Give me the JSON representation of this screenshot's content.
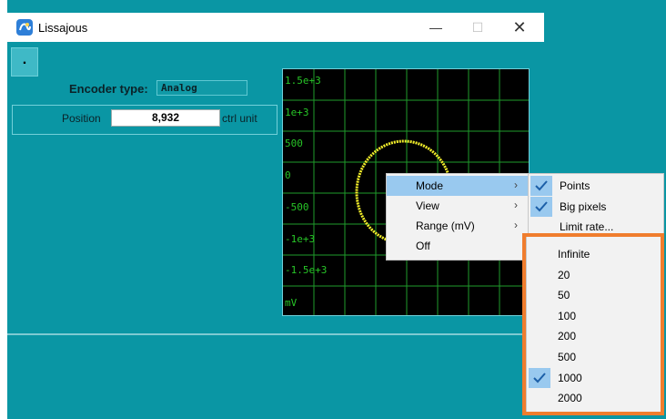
{
  "window": {
    "title": "Lissajous",
    "minimize_glyph": "—",
    "maximize_glyph": "☐",
    "close_glyph": "✕",
    "app_icon": "lissajous-app-icon"
  },
  "toolbar": {
    "dot_button_label": "."
  },
  "encoder": {
    "label": "Encoder type:",
    "value": "Analog"
  },
  "position": {
    "label": "Position",
    "value": "8,932",
    "unit": "ctrl unit"
  },
  "scope": {
    "y_labels": [
      "1.5e+3",
      "1e+3",
      "500",
      "0",
      "-500",
      "-1e+3",
      "-1.5e+3",
      "mV"
    ],
    "trace_color": "#f2ee2a",
    "grid_color": "#1f9b2b",
    "label_color": "#27c527"
  },
  "context_menu": {
    "items": [
      {
        "label": "Mode",
        "has_submenu": true,
        "highlighted": true
      },
      {
        "label": "View",
        "has_submenu": true,
        "highlighted": false
      },
      {
        "label": "Range (mV)",
        "has_submenu": true,
        "highlighted": false
      },
      {
        "label": "Off",
        "has_submenu": false,
        "highlighted": false
      }
    ],
    "arrow_glyph": "›"
  },
  "mode_submenu": {
    "items": [
      {
        "label": "Points",
        "checked": true
      },
      {
        "label": "Big pixels",
        "checked": true
      },
      {
        "label": "Limit rate...",
        "checked": false
      }
    ]
  },
  "rate_submenu": {
    "items": [
      {
        "label": "Infinite",
        "checked": false
      },
      {
        "label": "20",
        "checked": false
      },
      {
        "label": "50",
        "checked": false
      },
      {
        "label": "100",
        "checked": false
      },
      {
        "label": "200",
        "checked": false
      },
      {
        "label": "500",
        "checked": false
      },
      {
        "label": "1000",
        "checked": true
      },
      {
        "label": "2000",
        "checked": false
      }
    ],
    "highlight_outline_color": "#f07d2e"
  }
}
